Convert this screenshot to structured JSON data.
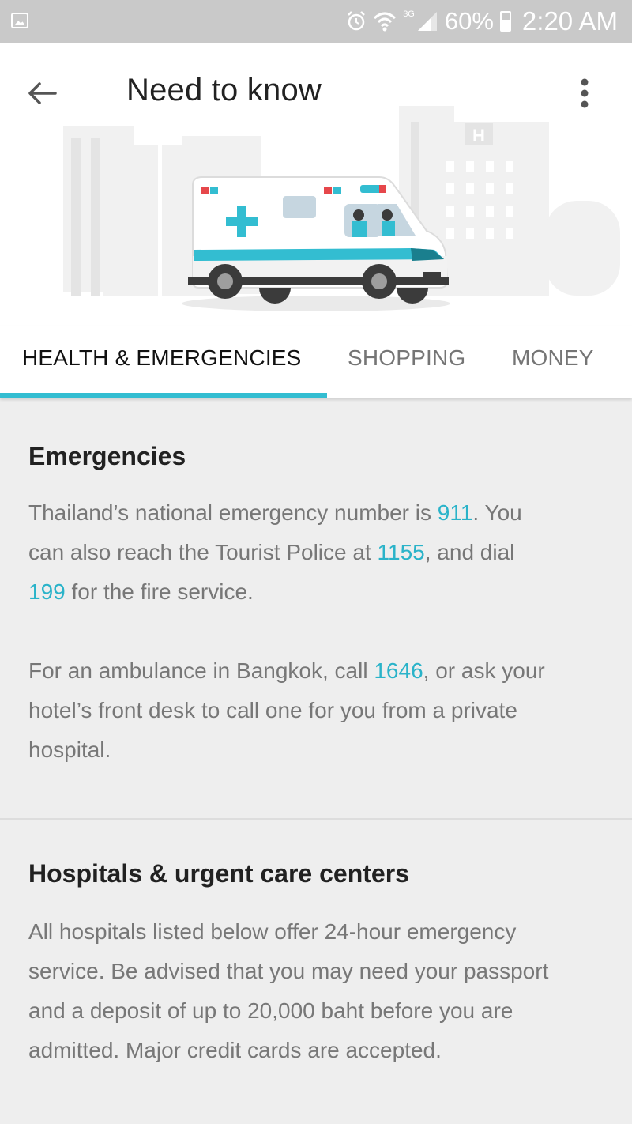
{
  "status_bar": {
    "network": "3G",
    "battery": "60%",
    "time": "2:20 AM"
  },
  "header": {
    "title": "Need to know",
    "icons": [
      "back-arrow-icon",
      "more-vert-icon",
      "ambulance-illustration"
    ],
    "hospital_sign": "H"
  },
  "tabs": [
    {
      "label": "HEALTH & EMERGENCIES",
      "active": true
    },
    {
      "label": "SHOPPING",
      "active": false
    },
    {
      "label": "MONEY",
      "active": false
    }
  ],
  "sections": {
    "emergencies": {
      "title": "Emergencies",
      "p1": {
        "t1": "Thailand’s national emergency number is ",
        "n1": "911",
        "t2": ". You",
        "t3": "can also reach the Tourist Police at ",
        "n2": "1155",
        "t4": ", and dial",
        "n3": "199",
        "t5": " for the fire service."
      },
      "p2": {
        "t1": "For an ambulance in Bangkok, call ",
        "n1": "1646",
        "t2": ", or ask your",
        "line2": "hotel’s front desk to call one for you from a private",
        "line3": "hospital."
      }
    },
    "hospitals": {
      "title": "Hospitals & urgent care centers",
      "lines": [
        "All hospitals listed below offer 24-hour emergency",
        "service. Be advised that you may need your passport",
        "and a deposit of up to 20,000 baht before you are",
        "admitted. Major credit cards are accepted."
      ]
    }
  },
  "colors": {
    "accent": "#33bdd1",
    "link": "#2ab3c9",
    "status_bar": "#c9c9c9",
    "body_bg": "#eeeeee"
  }
}
